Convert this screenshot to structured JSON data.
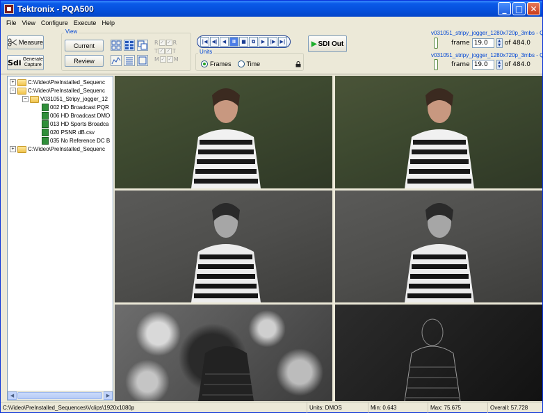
{
  "window": {
    "title": "Tektronix - PQA500",
    "controls": [
      "_",
      "□",
      "✕"
    ]
  },
  "menu": [
    "File",
    "View",
    "Configure",
    "Execute",
    "Help"
  ],
  "toolbar": {
    "measure_label": "Measure",
    "generate_label": "Generate\nCapture",
    "generate_badge": "Sdi",
    "view_group_label": "View",
    "current_label": "Current",
    "review_label": "Review",
    "rgb": {
      "rows": [
        "R",
        "T",
        "M"
      ],
      "cols": [
        "✓",
        "✓"
      ]
    },
    "transport": [
      "|◀",
      "◀|",
      "◀",
      "II",
      "■",
      "⧉",
      "▶",
      "|▶",
      "▶|"
    ],
    "units_label": "Units",
    "units_frames": "Frames",
    "units_time": "Time",
    "sdi_out_label": "SDI Out"
  },
  "files": [
    {
      "name": "v031051_stripy_jogger_1280x720p_3mbs - Q",
      "frame_label": "frame",
      "frame_value": "19.0",
      "of_label": "of 484.0"
    },
    {
      "name": "v031051_stripy_jogger_1280x720p_3mbs - Q",
      "frame_label": "frame",
      "frame_value": "19.0",
      "of_label": "of 484.0"
    }
  ],
  "tree": [
    {
      "level": 0,
      "expander": "+",
      "kind": "folder",
      "label": "C:\\Video\\PreInstalled_Sequenc"
    },
    {
      "level": 0,
      "expander": "−",
      "kind": "folder",
      "label": "C:\\Video\\PreInstalled_Sequenc"
    },
    {
      "level": 1,
      "expander": "−",
      "kind": "folder",
      "label": "V031051_Stripy_jogger_12"
    },
    {
      "level": 2,
      "expander": "",
      "kind": "file",
      "label": "002 HD Broadcast PQR"
    },
    {
      "level": 2,
      "expander": "",
      "kind": "file",
      "label": "006 HD Broadcast DMO"
    },
    {
      "level": 2,
      "expander": "",
      "kind": "file",
      "label": "013 HD Sports Broadca"
    },
    {
      "level": 2,
      "expander": "",
      "kind": "file",
      "label": "020 PSNR dB.csv"
    },
    {
      "level": 2,
      "expander": "",
      "kind": "file",
      "label": "035 No Reference DC B"
    },
    {
      "level": 0,
      "expander": "+",
      "kind": "folder",
      "label": "C:\\Video\\PreInstalled_Sequenc"
    }
  ],
  "status": {
    "path": "C:\\Video\\PreInstalled_Sequences\\Vclips\\1920x1080p",
    "units": "Units: DMOS",
    "min": "Min: 0.643",
    "max": "Max: 75.675",
    "overall": "Overall: 57.728"
  }
}
